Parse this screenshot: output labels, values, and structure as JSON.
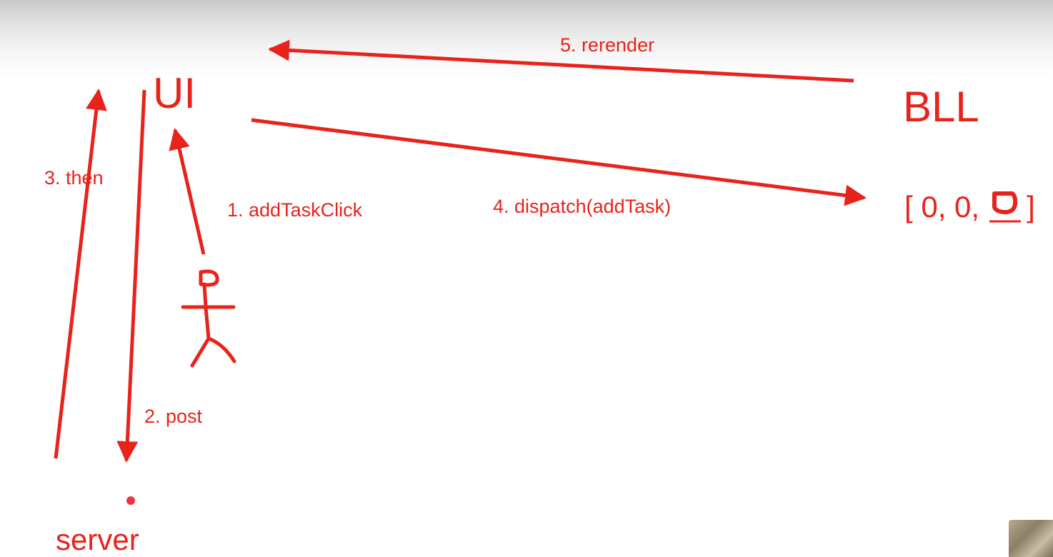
{
  "colors": {
    "ink": "#e8231b",
    "background": "#ffffff"
  },
  "nodes": {
    "ui": "UI",
    "bll": "BLL",
    "server": "server",
    "bll_array_prefix": "[ 0, 0,",
    "bll_array_suffix": "]"
  },
  "edges": [
    {
      "label": "1. addTaskClick"
    },
    {
      "label": "2. post"
    },
    {
      "label": "3. then"
    },
    {
      "label": "4. dispatch(addTask)"
    },
    {
      "label": "5. rerender"
    }
  ]
}
